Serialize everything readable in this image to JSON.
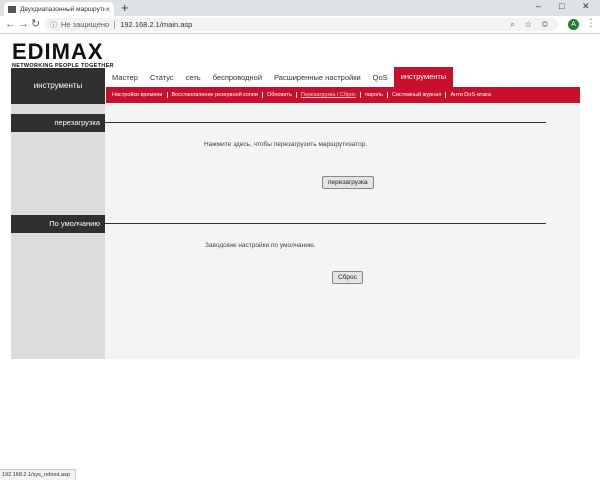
{
  "browser": {
    "tab_title": "Двухдиапазонный маршрутиз",
    "tab_close": "×",
    "new_tab": "+",
    "window_controls": [
      "–",
      "□",
      "✕"
    ],
    "nav": {
      "back": "←",
      "forward": "→",
      "reload": "↻"
    },
    "security_text": "Не защищено",
    "url": "192.168.2.1/main.asp",
    "tools_glyphs": "⌕ ☆ ◎",
    "avatar_letter": "А",
    "menu_glyph": "⋮",
    "status_url": "192.168.2.1/sys_reboot.asp"
  },
  "router": {
    "brand": "EDIMAX",
    "tagline": "NETWORKING PEOPLE TOGETHER",
    "side_title": "инструменты",
    "main_nav": [
      "Мастер",
      "Статус",
      "сеть",
      "беспроводной",
      "Расширенные настройки",
      "QoS",
      "инструменты"
    ],
    "main_nav_active": 6,
    "sub_nav": [
      "Настройки времени",
      "Восстановление резервной копии",
      "Обновить",
      "Перезагрузка / Сброс",
      "пароль",
      "Системный журнал",
      "Анти DoS-атака"
    ],
    "sub_nav_current": 3,
    "sections": {
      "reboot": {
        "title": "перезагрузка",
        "message": "Нажмите здесь, чтобы перезагрузить маршрутизатор.",
        "button": "перезагрузка"
      },
      "default": {
        "title": "По умолчанию",
        "message": "Заводские настройки по умолчанию.",
        "button": "Сброс"
      }
    }
  },
  "colors": {
    "accent": "#c8102e",
    "dark": "#303030",
    "content_bg": "#f4f4f4",
    "side_bg": "#dcdcdc"
  }
}
